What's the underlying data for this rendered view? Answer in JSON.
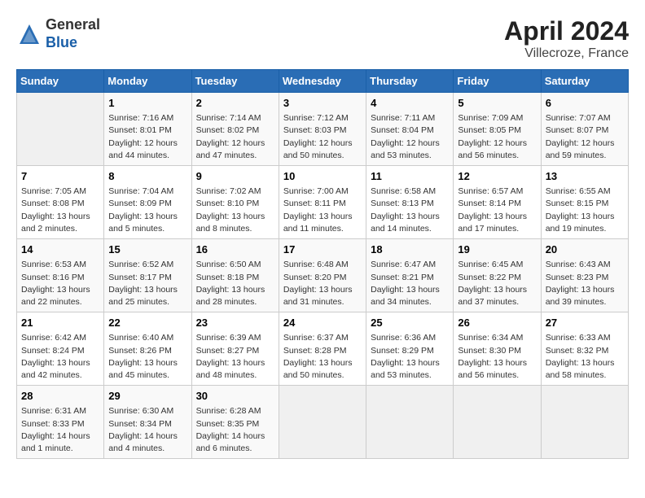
{
  "header": {
    "logo_line1": "General",
    "logo_line2": "Blue",
    "month_year": "April 2024",
    "location": "Villecroze, France"
  },
  "days_of_week": [
    "Sunday",
    "Monday",
    "Tuesday",
    "Wednesday",
    "Thursday",
    "Friday",
    "Saturday"
  ],
  "weeks": [
    [
      {
        "day": "",
        "info": ""
      },
      {
        "day": "1",
        "info": "Sunrise: 7:16 AM\nSunset: 8:01 PM\nDaylight: 12 hours\nand 44 minutes."
      },
      {
        "day": "2",
        "info": "Sunrise: 7:14 AM\nSunset: 8:02 PM\nDaylight: 12 hours\nand 47 minutes."
      },
      {
        "day": "3",
        "info": "Sunrise: 7:12 AM\nSunset: 8:03 PM\nDaylight: 12 hours\nand 50 minutes."
      },
      {
        "day": "4",
        "info": "Sunrise: 7:11 AM\nSunset: 8:04 PM\nDaylight: 12 hours\nand 53 minutes."
      },
      {
        "day": "5",
        "info": "Sunrise: 7:09 AM\nSunset: 8:05 PM\nDaylight: 12 hours\nand 56 minutes."
      },
      {
        "day": "6",
        "info": "Sunrise: 7:07 AM\nSunset: 8:07 PM\nDaylight: 12 hours\nand 59 minutes."
      }
    ],
    [
      {
        "day": "7",
        "info": "Sunrise: 7:05 AM\nSunset: 8:08 PM\nDaylight: 13 hours\nand 2 minutes."
      },
      {
        "day": "8",
        "info": "Sunrise: 7:04 AM\nSunset: 8:09 PM\nDaylight: 13 hours\nand 5 minutes."
      },
      {
        "day": "9",
        "info": "Sunrise: 7:02 AM\nSunset: 8:10 PM\nDaylight: 13 hours\nand 8 minutes."
      },
      {
        "day": "10",
        "info": "Sunrise: 7:00 AM\nSunset: 8:11 PM\nDaylight: 13 hours\nand 11 minutes."
      },
      {
        "day": "11",
        "info": "Sunrise: 6:58 AM\nSunset: 8:13 PM\nDaylight: 13 hours\nand 14 minutes."
      },
      {
        "day": "12",
        "info": "Sunrise: 6:57 AM\nSunset: 8:14 PM\nDaylight: 13 hours\nand 17 minutes."
      },
      {
        "day": "13",
        "info": "Sunrise: 6:55 AM\nSunset: 8:15 PM\nDaylight: 13 hours\nand 19 minutes."
      }
    ],
    [
      {
        "day": "14",
        "info": "Sunrise: 6:53 AM\nSunset: 8:16 PM\nDaylight: 13 hours\nand 22 minutes."
      },
      {
        "day": "15",
        "info": "Sunrise: 6:52 AM\nSunset: 8:17 PM\nDaylight: 13 hours\nand 25 minutes."
      },
      {
        "day": "16",
        "info": "Sunrise: 6:50 AM\nSunset: 8:18 PM\nDaylight: 13 hours\nand 28 minutes."
      },
      {
        "day": "17",
        "info": "Sunrise: 6:48 AM\nSunset: 8:20 PM\nDaylight: 13 hours\nand 31 minutes."
      },
      {
        "day": "18",
        "info": "Sunrise: 6:47 AM\nSunset: 8:21 PM\nDaylight: 13 hours\nand 34 minutes."
      },
      {
        "day": "19",
        "info": "Sunrise: 6:45 AM\nSunset: 8:22 PM\nDaylight: 13 hours\nand 37 minutes."
      },
      {
        "day": "20",
        "info": "Sunrise: 6:43 AM\nSunset: 8:23 PM\nDaylight: 13 hours\nand 39 minutes."
      }
    ],
    [
      {
        "day": "21",
        "info": "Sunrise: 6:42 AM\nSunset: 8:24 PM\nDaylight: 13 hours\nand 42 minutes."
      },
      {
        "day": "22",
        "info": "Sunrise: 6:40 AM\nSunset: 8:26 PM\nDaylight: 13 hours\nand 45 minutes."
      },
      {
        "day": "23",
        "info": "Sunrise: 6:39 AM\nSunset: 8:27 PM\nDaylight: 13 hours\nand 48 minutes."
      },
      {
        "day": "24",
        "info": "Sunrise: 6:37 AM\nSunset: 8:28 PM\nDaylight: 13 hours\nand 50 minutes."
      },
      {
        "day": "25",
        "info": "Sunrise: 6:36 AM\nSunset: 8:29 PM\nDaylight: 13 hours\nand 53 minutes."
      },
      {
        "day": "26",
        "info": "Sunrise: 6:34 AM\nSunset: 8:30 PM\nDaylight: 13 hours\nand 56 minutes."
      },
      {
        "day": "27",
        "info": "Sunrise: 6:33 AM\nSunset: 8:32 PM\nDaylight: 13 hours\nand 58 minutes."
      }
    ],
    [
      {
        "day": "28",
        "info": "Sunrise: 6:31 AM\nSunset: 8:33 PM\nDaylight: 14 hours\nand 1 minute."
      },
      {
        "day": "29",
        "info": "Sunrise: 6:30 AM\nSunset: 8:34 PM\nDaylight: 14 hours\nand 4 minutes."
      },
      {
        "day": "30",
        "info": "Sunrise: 6:28 AM\nSunset: 8:35 PM\nDaylight: 14 hours\nand 6 minutes."
      },
      {
        "day": "",
        "info": ""
      },
      {
        "day": "",
        "info": ""
      },
      {
        "day": "",
        "info": ""
      },
      {
        "day": "",
        "info": ""
      }
    ]
  ]
}
